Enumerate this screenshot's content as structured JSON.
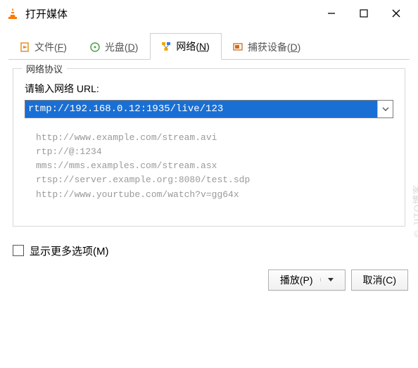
{
  "window": {
    "title": "打开媒体"
  },
  "tabs": {
    "file": "文件(",
    "file_u": "F",
    "file_end": ")",
    "disc": "光盘(",
    "disc_u": "D",
    "disc_end": ")",
    "network": "网络(",
    "network_u": "N",
    "network_end": ")",
    "capture": "捕获设备(",
    "capture_u": "D",
    "capture_end": ")"
  },
  "group": {
    "legend": "网络协议",
    "label": "请输入网络 URL:",
    "url_value": "rtmp://192.168.0.12:1935/live/123",
    "examples": {
      "e1": "http://www.example.com/stream.avi",
      "e2": "rtp://@:1234",
      "e3": "mms://mms.examples.com/stream.asx",
      "e4": "rtsp://server.example.org:8080/test.sdp",
      "e5": "http://www.yourtube.com/watch?v=gg64x"
    }
  },
  "more": {
    "label_pre": "显示更多选项(",
    "u": "M",
    "end": ")"
  },
  "buttons": {
    "play_pre": "播放(",
    "play_u": "P",
    "play_end": ")",
    "cancel_pre": "取消(",
    "cancel_u": "C",
    "cancel_end": ")"
  },
  "watermark": "© JITO博客"
}
